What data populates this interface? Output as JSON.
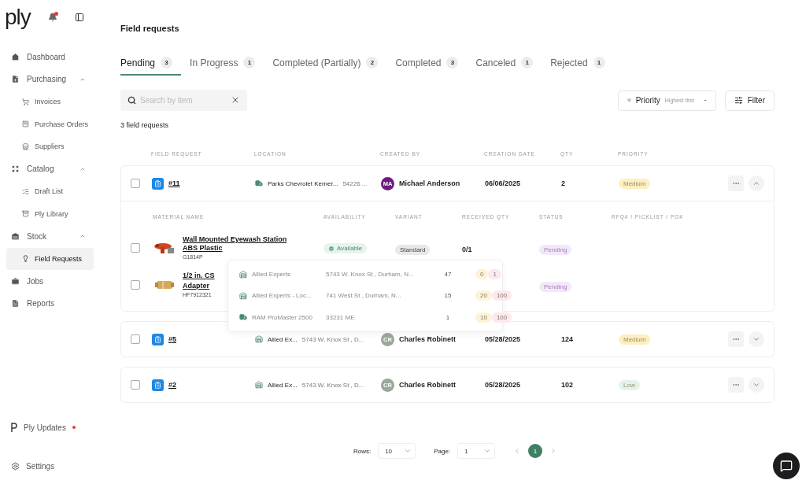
{
  "app": {
    "logo": "ply",
    "has_notifications": true
  },
  "sidebar": {
    "items": [
      {
        "label": "Dashboard",
        "selected": false
      },
      {
        "label": "Purchasing",
        "selected": false,
        "expanded": true,
        "children": [
          {
            "label": "Invoices",
            "selected": false
          },
          {
            "label": "Purchase Orders",
            "selected": false
          },
          {
            "label": "Suppliers",
            "selected": false
          }
        ]
      },
      {
        "label": "Catalog",
        "selected": false,
        "expanded": true,
        "children": [
          {
            "label": "Draft List",
            "selected": false
          },
          {
            "label": "Ply Library",
            "selected": false
          }
        ]
      },
      {
        "label": "Stock",
        "selected": false,
        "expanded": true,
        "children": [
          {
            "label": "Field Requests",
            "selected": true
          }
        ]
      },
      {
        "label": "Jobs",
        "selected": false
      },
      {
        "label": "Reports",
        "selected": false
      }
    ],
    "updates": {
      "label": "Ply Updates",
      "unread": true
    },
    "settings": {
      "label": "Settings"
    }
  },
  "page": {
    "title": "Field requests"
  },
  "tabs": [
    {
      "label": "Pending",
      "count": "3",
      "selected": true
    },
    {
      "label": "In Progress",
      "count": "1",
      "selected": false
    },
    {
      "label": "Completed (Partially)",
      "count": "2",
      "selected": false
    },
    {
      "label": "Completed",
      "count": "3",
      "selected": false
    },
    {
      "label": "Canceled",
      "count": "1",
      "selected": false
    },
    {
      "label": "Rejected",
      "count": "1",
      "selected": false
    }
  ],
  "search": {
    "placeholder": "Search by item"
  },
  "sort": {
    "label": "Priority",
    "order": "Highest first"
  },
  "filter": {
    "label": "Filter"
  },
  "result_count": "3 field requests",
  "table": {
    "columns": [
      "FIELD REQUEST",
      "LOCATION",
      "CREATED BY",
      "CREATION DATE",
      "QTY",
      "PRIORITY"
    ],
    "rows": [
      {
        "checked": false,
        "id": "#11",
        "location": {
          "kind": "vehicle",
          "name": "Parks Chevrolet Kerner...",
          "address": "54226 ..."
        },
        "creator": {
          "initials": "MA",
          "name": "Michael Anderson",
          "color": "#6c1d7c"
        },
        "date": "06/06/2025",
        "qty": "2",
        "priority": {
          "label": "Medium",
          "color": "#fcefc0"
        },
        "expanded": true,
        "materials": {
          "columns": [
            "MATERIAL NAME",
            "AVAILABILITY",
            "VARIANT",
            "RECEIVED QTY",
            "STATUS",
            "RFQ# / PICKLIST / PO#"
          ],
          "items": [
            {
              "checked": false,
              "name": "Wall Mounted Eyewash Station ABS Plastic",
              "sku": "G1814P",
              "availability": "Available",
              "variant": "Standard",
              "received": "0/1",
              "status": {
                "label": "Pending",
                "color": "#f1e9f7"
              }
            },
            {
              "checked": false,
              "name": "1/2 in. CS",
              "name_line_2": "Adapter",
              "sku": "HF7912321",
              "status": {
                "label": "Pending",
                "color": "#f1e9f7"
              }
            }
          ]
        },
        "stock_popup": [
          {
            "kind": "warehouse",
            "name": "Allied Experts",
            "address": "5743 W. Knox St , Durham, N...",
            "qty": "47",
            "min": "0",
            "max": "1"
          },
          {
            "kind": "warehouse",
            "name": "Allied Experts - Loc...",
            "address": "741 West St , Durham, N...",
            "qty": "15",
            "min": "20",
            "max": "100"
          },
          {
            "kind": "vehicle",
            "name": "RAM ProMaster 2500",
            "address": "33231 ME",
            "qty": "1",
            "min": "10",
            "max": "100"
          }
        ]
      },
      {
        "checked": false,
        "id": "#5",
        "location": {
          "kind": "warehouse",
          "name": "Allied Ex...",
          "address": "5743 W. Knox St , D..."
        },
        "creator": {
          "initials": "CR",
          "name": "Charles Robinett",
          "color": "#9aa89a"
        },
        "date": "05/28/2025",
        "qty": "124",
        "priority": {
          "label": "Medium",
          "color": "#fcefc0"
        },
        "expanded": false
      },
      {
        "checked": false,
        "id": "#2",
        "location": {
          "kind": "warehouse",
          "name": "Allied Ex...",
          "address": "5743 W. Knox St , D..."
        },
        "creator": {
          "initials": "CR",
          "name": "Charles Robinett",
          "color": "#9aa89a"
        },
        "date": "05/28/2025",
        "qty": "102",
        "priority": {
          "label": "Low",
          "color": "#e4f3ea"
        },
        "expanded": false
      }
    ]
  },
  "pagination": {
    "rows_label": "Rows:",
    "rows_value": "10",
    "page_label": "Page:",
    "page_value": "1",
    "pages": [
      {
        "label": "1",
        "selected": true
      }
    ]
  }
}
